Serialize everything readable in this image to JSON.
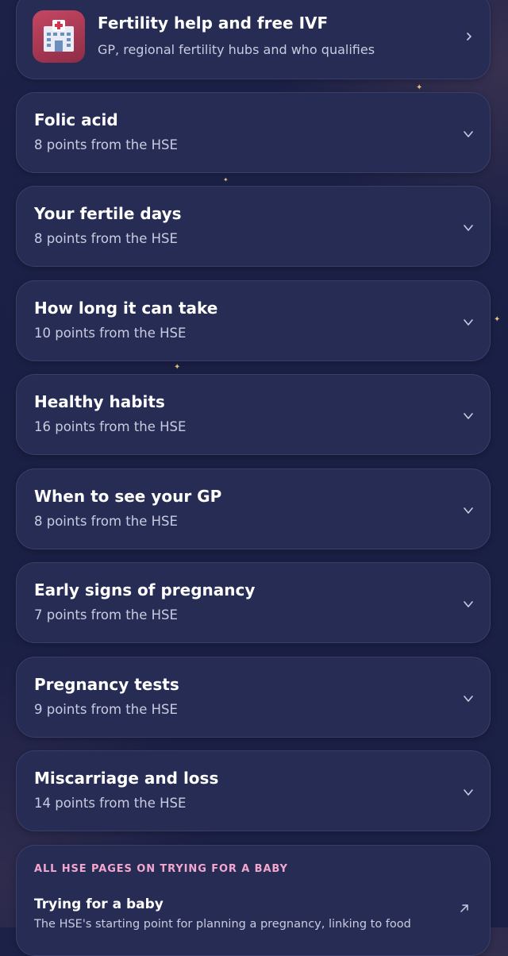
{
  "hub": {
    "title": "Fertility help and free IVF",
    "subtitle": "GP, regional fertility hubs and who qualifies",
    "icon": "hospital-icon",
    "chevron": "chevron-right-icon"
  },
  "sections": [
    {
      "title": "Folic acid",
      "subtitle": "8 points from the HSE"
    },
    {
      "title": "Your fertile days",
      "subtitle": "8 points from the HSE"
    },
    {
      "title": "How long it can take",
      "subtitle": "10 points from the HSE"
    },
    {
      "title": "Healthy habits",
      "subtitle": "16 points from the HSE"
    },
    {
      "title": "When to see your GP",
      "subtitle": "8 points from the HSE"
    },
    {
      "title": "Early signs of pregnancy",
      "subtitle": "7 points from the HSE"
    },
    {
      "title": "Pregnancy tests",
      "subtitle": "9 points from the HSE"
    },
    {
      "title": "Miscarriage and loss",
      "subtitle": "14 points from the HSE"
    }
  ],
  "hse_links": {
    "heading": "ALL HSE PAGES ON TRYING FOR A BABY",
    "items": [
      {
        "title": "Trying for a baby",
        "description": "The HSE's starting point for planning a pregnancy, linking to food"
      }
    ]
  },
  "colors": {
    "background": "#1b2046",
    "card": "#272c54",
    "accent_pink": "#f2a7cf",
    "hub_icon": "#b33f5a",
    "sparkle": "#e7c07d"
  }
}
